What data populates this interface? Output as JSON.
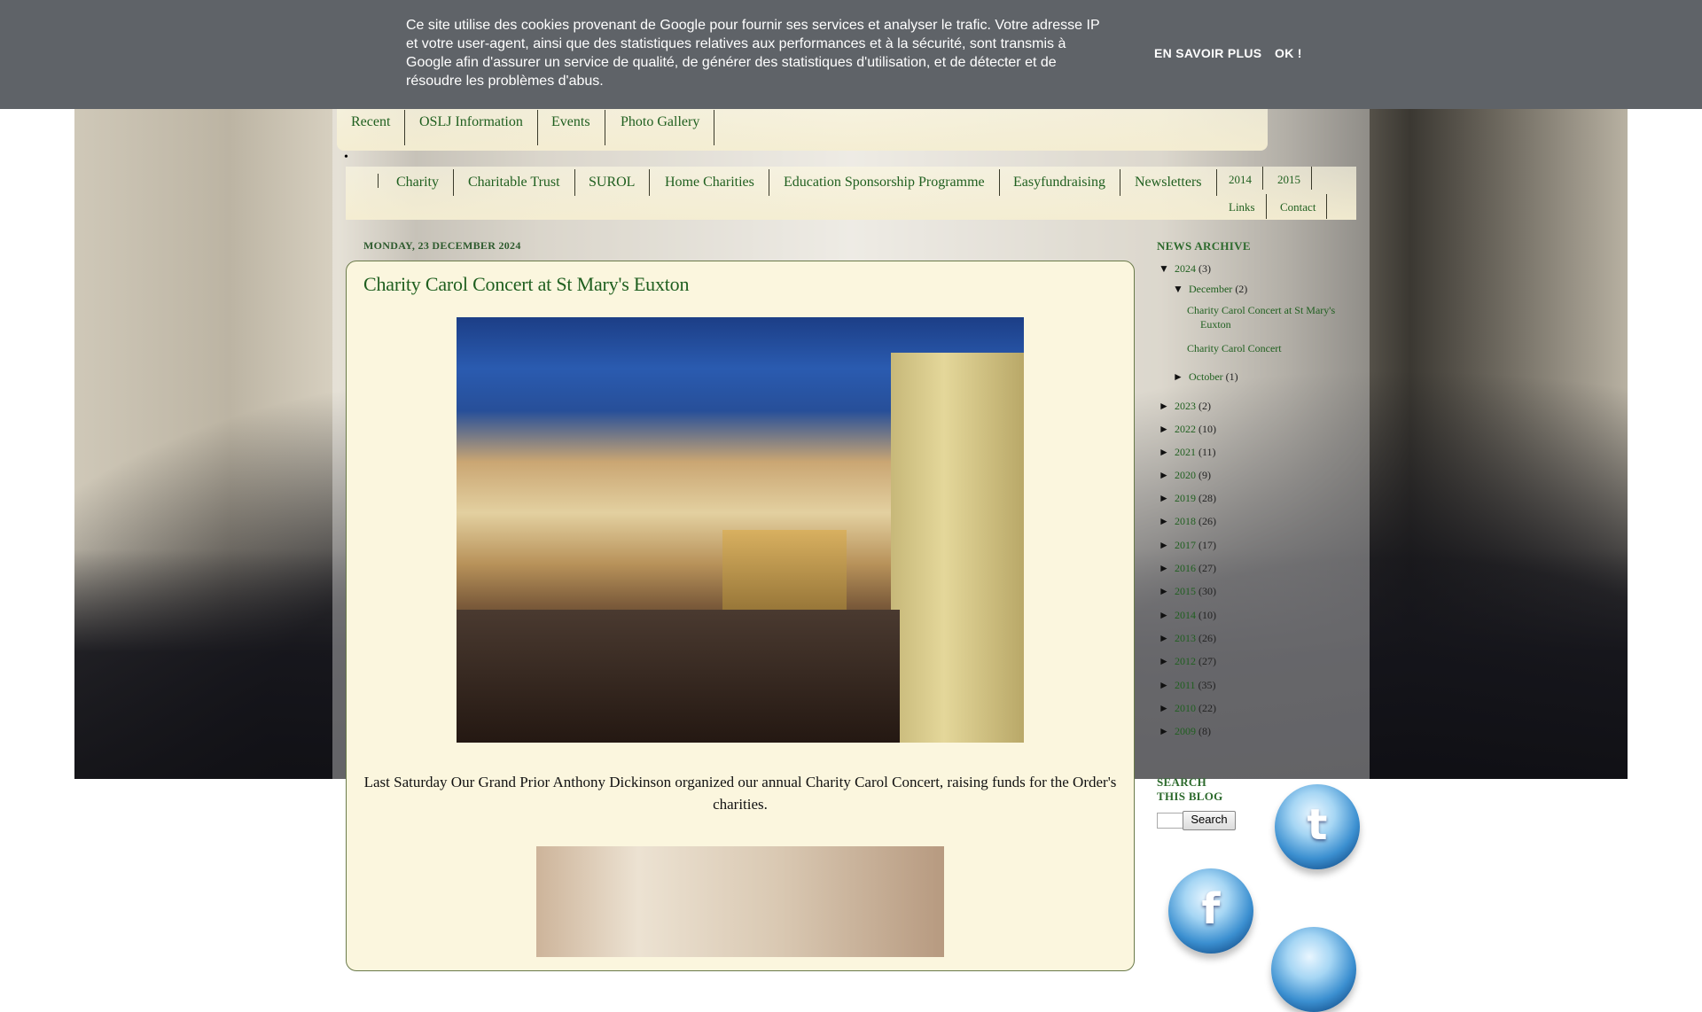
{
  "cookie_banner": {
    "text": "Ce site utilise des cookies provenant de Google pour fournir ses services et analyser le trafic. Votre adresse IP et votre user-agent, ainsi que des statistiques relatives aux performances et à la sécurité, sont transmis à Google afin d'assurer un service de qualité, de générer des statistiques d'utilisation, et de détecter et de résoudre les problèmes d'abus.",
    "learn_more": "EN SAVOIR PLUS",
    "ok": "OK !"
  },
  "top_nav": [
    "Recent",
    "OSLJ Information",
    "Events",
    "Photo Gallery"
  ],
  "bullet": "•",
  "sub_nav": {
    "main": [
      "Charity",
      "Charitable Trust",
      "SUROL",
      "Home Charities",
      "Education Sponsorship Programme",
      "Easyfundraising",
      "Newsletters"
    ],
    "extra_row1": [
      "2014",
      "2015"
    ],
    "extra_row2": [
      "Links",
      "Contact"
    ]
  },
  "post": {
    "date": "MONDAY, 23 DECEMBER 2024",
    "title": "Charity Carol Concert at St Mary's Euxton",
    "body": "Last Saturday Our Grand Prior Anthony Dickinson organized our annual Charity Carol Concert, raising funds for the Order's charities."
  },
  "sidebar": {
    "archive_title": "NEWS ARCHIVE",
    "expanded_year": {
      "toggle": "▼",
      "year": "2024",
      "count": "(3)"
    },
    "expanded_month": {
      "toggle": "▼",
      "month": "December",
      "count": "(2)"
    },
    "posts": [
      "Charity Carol Concert at St Mary's Euxton",
      "Charity Carol Concert"
    ],
    "collapsed_month": {
      "toggle": "►",
      "month": "October",
      "count": "(1)"
    },
    "years": [
      {
        "toggle": "►",
        "year": "2023",
        "count": "(2)"
      },
      {
        "toggle": "►",
        "year": "2022",
        "count": "(10)"
      },
      {
        "toggle": "►",
        "year": "2021",
        "count": "(11)"
      },
      {
        "toggle": "►",
        "year": "2020",
        "count": "(9)"
      },
      {
        "toggle": "►",
        "year": "2019",
        "count": "(28)"
      },
      {
        "toggle": "►",
        "year": "2018",
        "count": "(26)"
      },
      {
        "toggle": "►",
        "year": "2017",
        "count": "(17)"
      },
      {
        "toggle": "►",
        "year": "2016",
        "count": "(27)"
      },
      {
        "toggle": "►",
        "year": "2015",
        "count": "(30)"
      },
      {
        "toggle": "►",
        "year": "2014",
        "count": "(10)"
      },
      {
        "toggle": "►",
        "year": "2013",
        "count": "(26)"
      },
      {
        "toggle": "►",
        "year": "2012",
        "count": "(27)"
      },
      {
        "toggle": "►",
        "year": "2011",
        "count": "(35)"
      },
      {
        "toggle": "►",
        "year": "2010",
        "count": "(22)"
      },
      {
        "toggle": "►",
        "year": "2009",
        "count": "(8)"
      }
    ],
    "search_title_line1": "SEARCH",
    "search_title_line2": "THIS BLOG",
    "search_button": "Search",
    "social": {
      "twitter_glyph": "t",
      "facebook_glyph": "f"
    }
  },
  "colors": {
    "link_green": "#1f5f1f",
    "cookie_bg": "#5f6368",
    "post_bg": "#fbf6de"
  }
}
